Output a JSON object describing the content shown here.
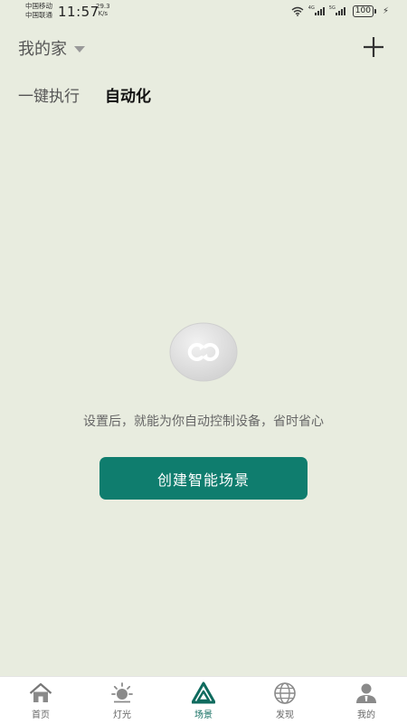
{
  "status_bar": {
    "carrier_1": "中国移动",
    "carrier_2": "中国联通",
    "time": "11:57",
    "speed_value": "29.3",
    "speed_unit": "K/s",
    "sim1_tag": "4G",
    "sim2_tag": "5G",
    "battery": "100"
  },
  "header": {
    "home_name": "我的家"
  },
  "tabs": [
    {
      "label": "一键执行",
      "active": false
    },
    {
      "label": "自动化",
      "active": true
    }
  ],
  "empty_state": {
    "icon": "automation-loop-icon",
    "message": "设置后，就能为你自动控制设备，省时省心",
    "button_label": "创建智能场景"
  },
  "bottom_nav": [
    {
      "label": "首页",
      "icon": "home-icon",
      "active": false
    },
    {
      "label": "灯光",
      "icon": "light-icon",
      "active": false
    },
    {
      "label": "场景",
      "icon": "scene-icon",
      "active": true
    },
    {
      "label": "发现",
      "icon": "discover-globe-icon",
      "active": false
    },
    {
      "label": "我的",
      "icon": "profile-icon",
      "active": false
    }
  ],
  "colors": {
    "background": "#e8ecdf",
    "accent": "#0f7d6e",
    "nav_active": "#0f6b5e"
  }
}
